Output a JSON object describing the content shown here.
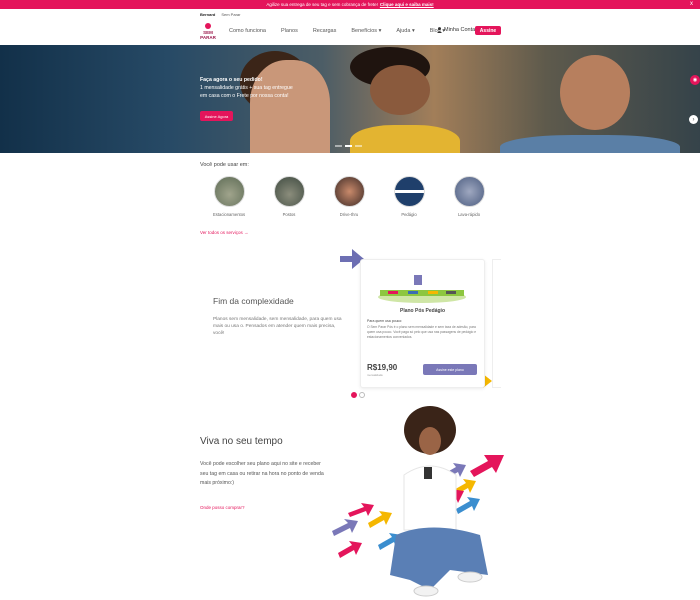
{
  "topbar": {
    "text": "Agilize sua entrega de seu tag e sem cobrança de frete!",
    "link": "Clique aqui e saiba mais!",
    "close": "x"
  },
  "subbar": {
    "brand": "Bernard",
    "sub": "Sem Parar"
  },
  "header": {
    "logo_line1": "SEM",
    "logo_line2": "PARAR",
    "nav": [
      "Como funciona",
      "Planos",
      "Recargas",
      "Benefícios ▾",
      "Ajuda ▾",
      "Blog ▾"
    ],
    "login": "Minha Conta",
    "cta": "Assine"
  },
  "hero": {
    "title": "Faça agora o seu pedido!",
    "line1": "1 mensalidade grátis + sua tag entregue",
    "line2": "em casa com o Frete por nossa conta!",
    "cta": "Assine Agora"
  },
  "uses": {
    "title": "Você pode usar em:",
    "items": [
      "Estacionamentos",
      "Postos",
      "Drive-thru",
      "Pedágio",
      "Lava-rápido"
    ],
    "all_link": "Ver todos os serviços →"
  },
  "plan": {
    "heading": "Fim da complexidade",
    "text": "Planos sem mensalidade, sem mensalidade, para quem usa mais ou usa o. Pensados em atender quem mais precisa, você!"
  },
  "card": {
    "title": "Plano Pós Pedágio",
    "tagline": "Para quem usa pouco:",
    "description": "O Sem Parar Pós é o plano sem mensalidade e sem taxa de adesão, para quem usa pouco. Você paga só pelo que usa nas passagens de pedágio e estacionamentos conveniados.",
    "price": "R$19,90",
    "price_note": "mensalidade",
    "button": "Assine este plano"
  },
  "viva": {
    "heading": "Viva no seu tempo",
    "text": "Você pode escolher seu plano aqui no site e receber seu tag em casa ou retirar na hora no ponto de venda mais próximo:)",
    "link": "Onde posso comprar?"
  },
  "colors": {
    "brand": "#e4155b",
    "accent_purple": "#7a78b8",
    "yellow": "#f5b700"
  }
}
